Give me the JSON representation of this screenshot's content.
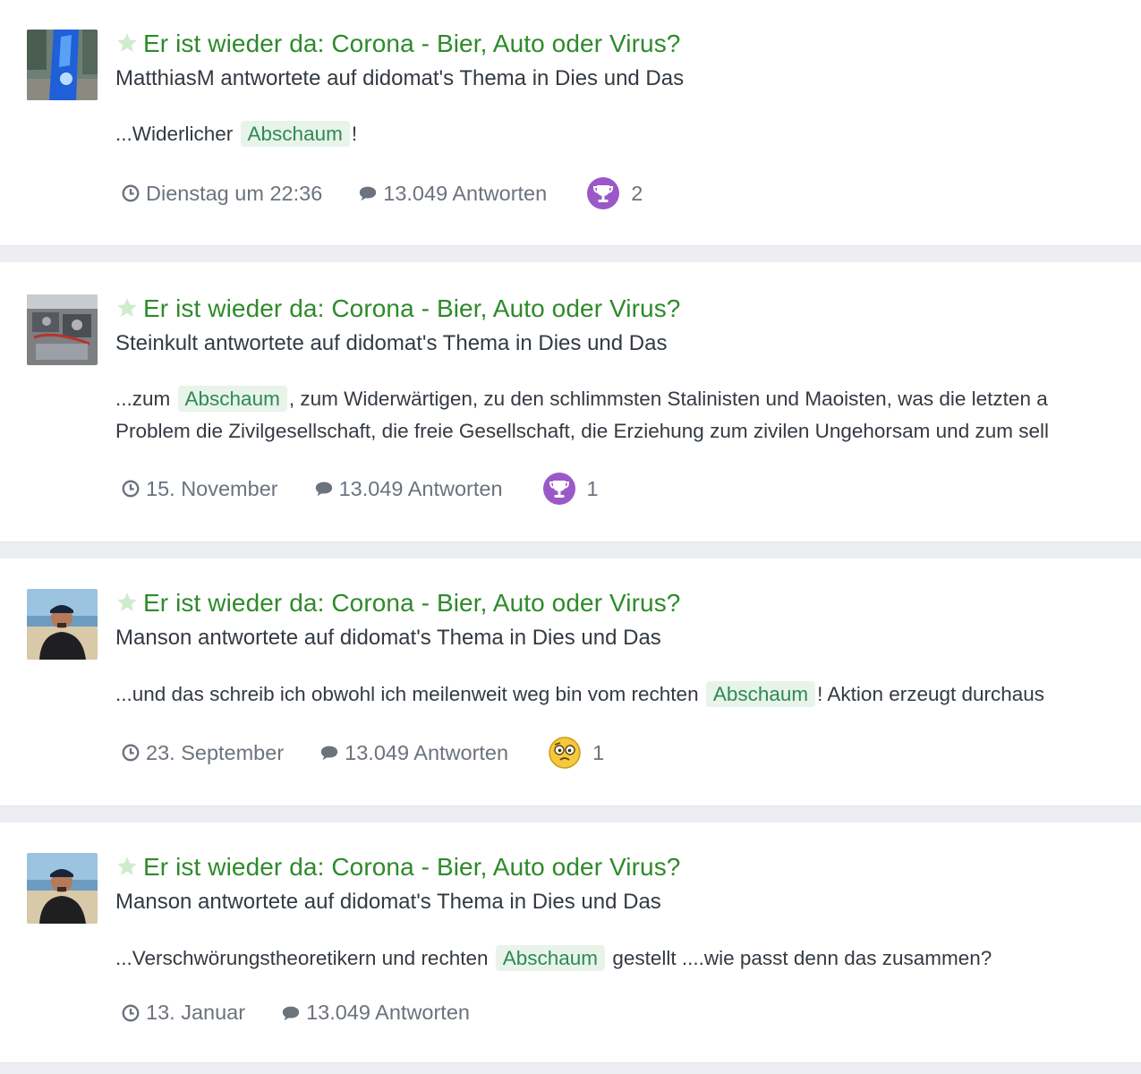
{
  "results": [
    {
      "title": "Er ist wieder da: Corona - Bier, Auto oder Virus?",
      "byline": "MatthiasM antwortete auf didomat's Thema in Dies und Das",
      "snippet_lines": [
        {
          "before": "...Widerlicher ",
          "highlight": "Abschaum",
          "after": "!"
        }
      ],
      "date": "Dienstag um 22:36",
      "replies": "13.049 Antworten",
      "reaction_icon": "trophy-icon",
      "reaction_count": "2"
    },
    {
      "title": "Er ist wieder da: Corona - Bier, Auto oder Virus?",
      "byline": "Steinkult antwortete auf didomat's Thema in Dies und Das",
      "snippet_lines": [
        {
          "before": "...zum ",
          "highlight": "Abschaum",
          "after": ", zum Widerwärtigen, zu den schlimmsten Stalinisten und Maoisten, was die letzten a"
        },
        {
          "before": "Problem die Zivilgesellschaft, die freie Gesellschaft, die Erziehung zum zivilen Ungehorsam und zum sell",
          "highlight": "",
          "after": ""
        }
      ],
      "date": "15. November",
      "replies": "13.049 Antworten",
      "reaction_icon": "trophy-icon",
      "reaction_count": "1"
    },
    {
      "title": "Er ist wieder da: Corona - Bier, Auto oder Virus?",
      "byline": "Manson antwortete auf didomat's Thema in Dies und Das",
      "snippet_lines": [
        {
          "before": "...und das schreib ich obwohl ich meilenweit weg bin vom rechten ",
          "highlight": "Abschaum",
          "after": "! Aktion erzeugt durchaus"
        }
      ],
      "date": "23. September",
      "replies": "13.049 Antworten",
      "reaction_icon": "confused-face-icon",
      "reaction_count": "1"
    },
    {
      "title": "Er ist wieder da: Corona - Bier, Auto oder Virus?",
      "byline": "Manson antwortete auf didomat's Thema in Dies und Das",
      "snippet_lines": [
        {
          "before": "...Verschwörungstheoretikern und rechten ",
          "highlight": "Abschaum",
          "after": " gestellt ....wie passt denn das zusammen?"
        }
      ],
      "date": "13. Januar",
      "replies": "13.049 Antworten",
      "reaction_icon": "",
      "reaction_count": ""
    }
  ],
  "colors": {
    "title_green": "#2e8a2a",
    "highlight_bg": "#e8f3ea",
    "highlight_text": "#2e8a55",
    "trophy_purple": "#9b59c8",
    "meta_gray": "#6b737d"
  }
}
